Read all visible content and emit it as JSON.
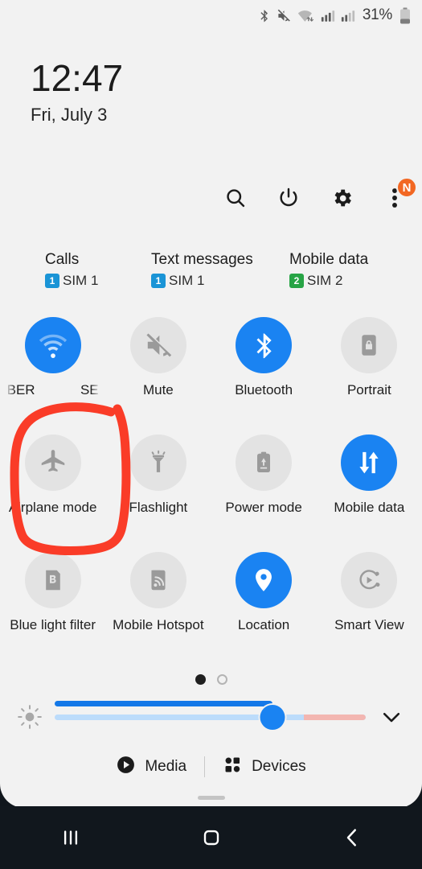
{
  "status_bar": {
    "icons": [
      "bluetooth-icon",
      "mute-icon",
      "wifi-data-icon",
      "signal-sim1-icon",
      "signal-sim2-icon"
    ],
    "battery_percent": "31%"
  },
  "clock": {
    "time": "12:47",
    "date": "Fri, July 3"
  },
  "header_actions": [
    {
      "name": "search-icon",
      "label": "Search"
    },
    {
      "name": "power-icon",
      "label": "Power off"
    },
    {
      "name": "settings-icon",
      "label": "Settings"
    },
    {
      "name": "more-options-icon",
      "label": "More options",
      "badge": "N"
    }
  ],
  "sim_row": [
    {
      "title": "Calls",
      "chip": "1",
      "chip_color": "#1a94d6",
      "sub": "SIM 1"
    },
    {
      "title": "Text messages",
      "chip": "1",
      "chip_color": "#1a94d6",
      "sub": "SIM 1"
    },
    {
      "title": "Mobile data",
      "chip": "2",
      "chip_color": "#27a445",
      "sub": "SIM 2"
    }
  ],
  "tiles": [
    {
      "icon": "wifi-icon",
      "label": "",
      "label_left": "BER",
      "label_right": "SE",
      "state": "on",
      "marquee": true
    },
    {
      "icon": "mute-icon",
      "label": "Mute",
      "state": "off"
    },
    {
      "icon": "bluetooth-icon",
      "label": "Bluetooth",
      "state": "on"
    },
    {
      "icon": "portrait-lock-icon",
      "label": "Portrait",
      "state": "off"
    },
    {
      "icon": "airplane-icon",
      "label": "Airplane mode",
      "state": "off",
      "annotated": true
    },
    {
      "icon": "flashlight-icon",
      "label": "Flashlight",
      "state": "off"
    },
    {
      "icon": "power-mode-icon",
      "label": "Power mode",
      "state": "off"
    },
    {
      "icon": "mobile-data-icon",
      "label": "Mobile data",
      "state": "on"
    },
    {
      "icon": "blue-light-icon",
      "label": "Blue light filter",
      "state": "off"
    },
    {
      "icon": "hotspot-icon",
      "label": "Mobile Hotspot",
      "state": "off"
    },
    {
      "icon": "location-icon",
      "label": "Location",
      "state": "on"
    },
    {
      "icon": "smart-view-icon",
      "label": "Smart View",
      "state": "off"
    }
  ],
  "page_dots": {
    "count": 2,
    "active_index": 0
  },
  "brightness": {
    "icon": "brightness-icon",
    "value_percent": 70,
    "expand_icon": "chevron-down-icon"
  },
  "media_bar": {
    "media_label": "Media",
    "media_icon": "play-circle-icon",
    "devices_label": "Devices",
    "devices_icon": "devices-grid-icon"
  },
  "nav_bar": {
    "recents": "recents-icon",
    "home": "home-icon",
    "back": "back-icon"
  },
  "annotation": {
    "shape": "hand-drawn-rounded-rect",
    "color": "#fa3c28",
    "targets": "Airplane mode"
  },
  "colors": {
    "panel_bg": "#f2f2f2",
    "tile_on": "#1a83f2",
    "tile_off": "#e3e3e3",
    "badge": "#f26722",
    "nav_bg": "#11171d"
  }
}
